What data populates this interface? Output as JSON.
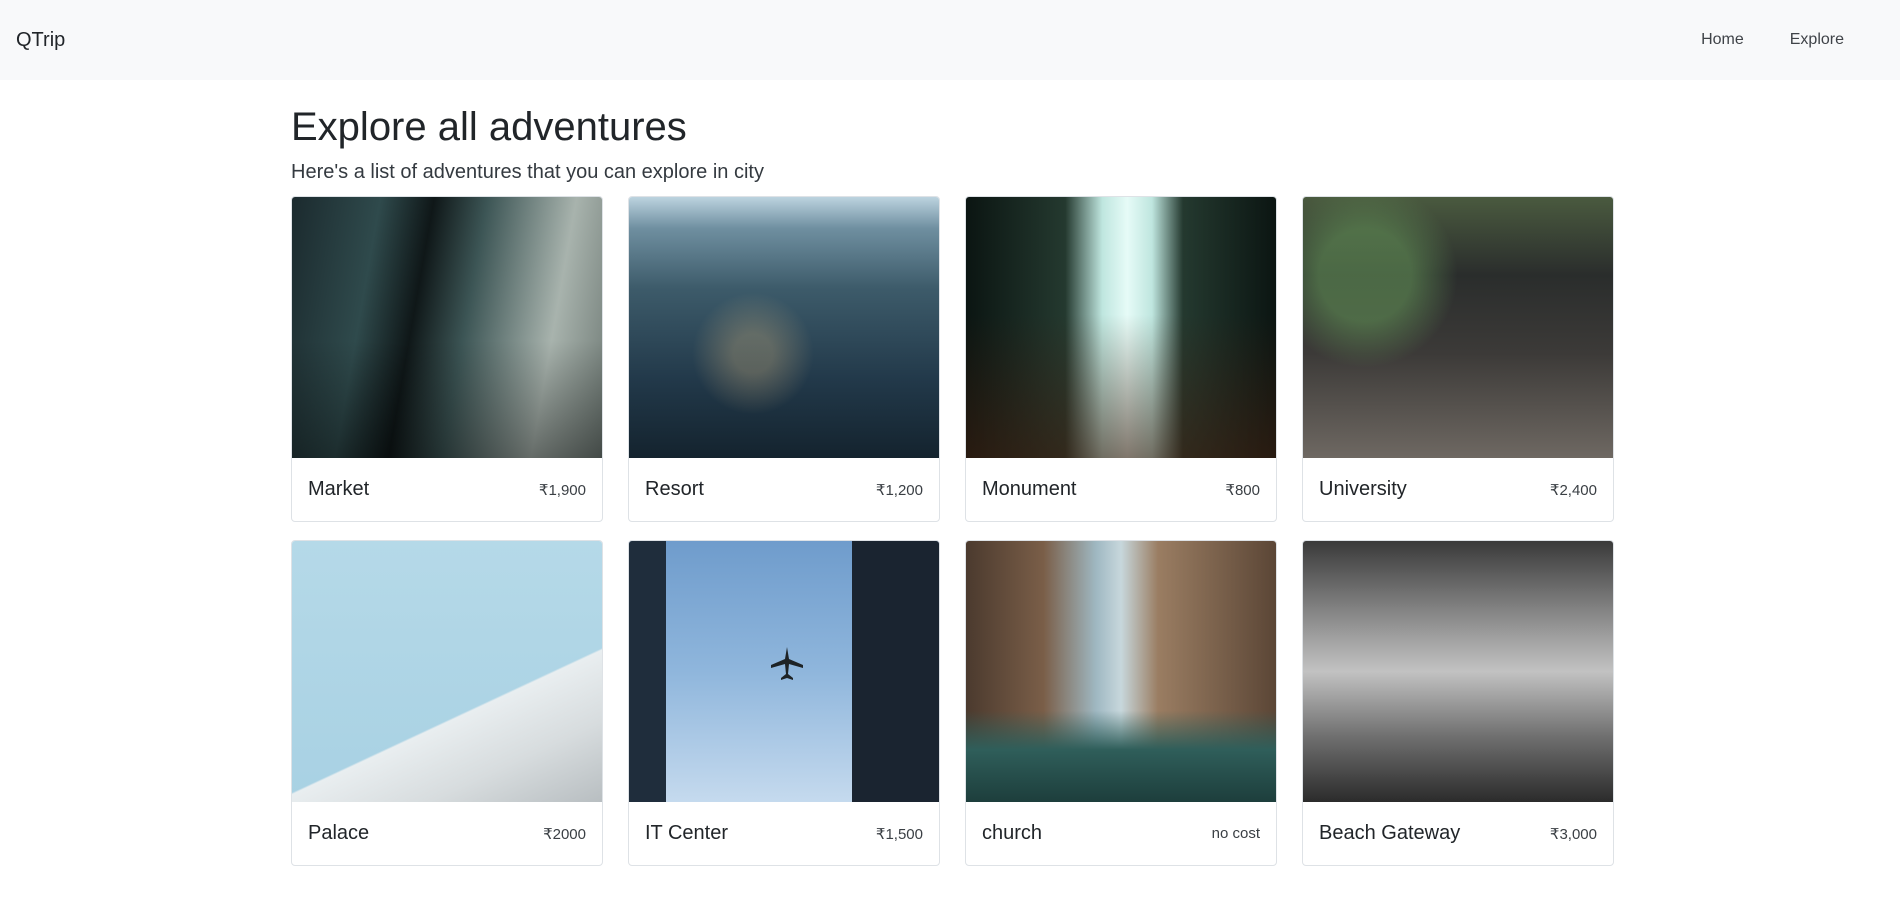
{
  "navbar": {
    "brand": "QTrip",
    "links": [
      {
        "label": "Home"
      },
      {
        "label": "Explore"
      }
    ]
  },
  "main": {
    "title": "Explore all adventures",
    "subtitle": "Here's a list of adventures that you can explore in city"
  },
  "adventures": [
    {
      "name": "Market",
      "price": "₹1,900"
    },
    {
      "name": "Resort",
      "price": "₹1,200"
    },
    {
      "name": "Monument",
      "price": "₹800"
    },
    {
      "name": "University",
      "price": "₹2,400"
    },
    {
      "name": "Palace",
      "price": "₹2000"
    },
    {
      "name": "IT Center",
      "price": "₹1,500"
    },
    {
      "name": "church",
      "price": "no cost"
    },
    {
      "name": "Beach Gateway",
      "price": "₹3,000"
    }
  ]
}
